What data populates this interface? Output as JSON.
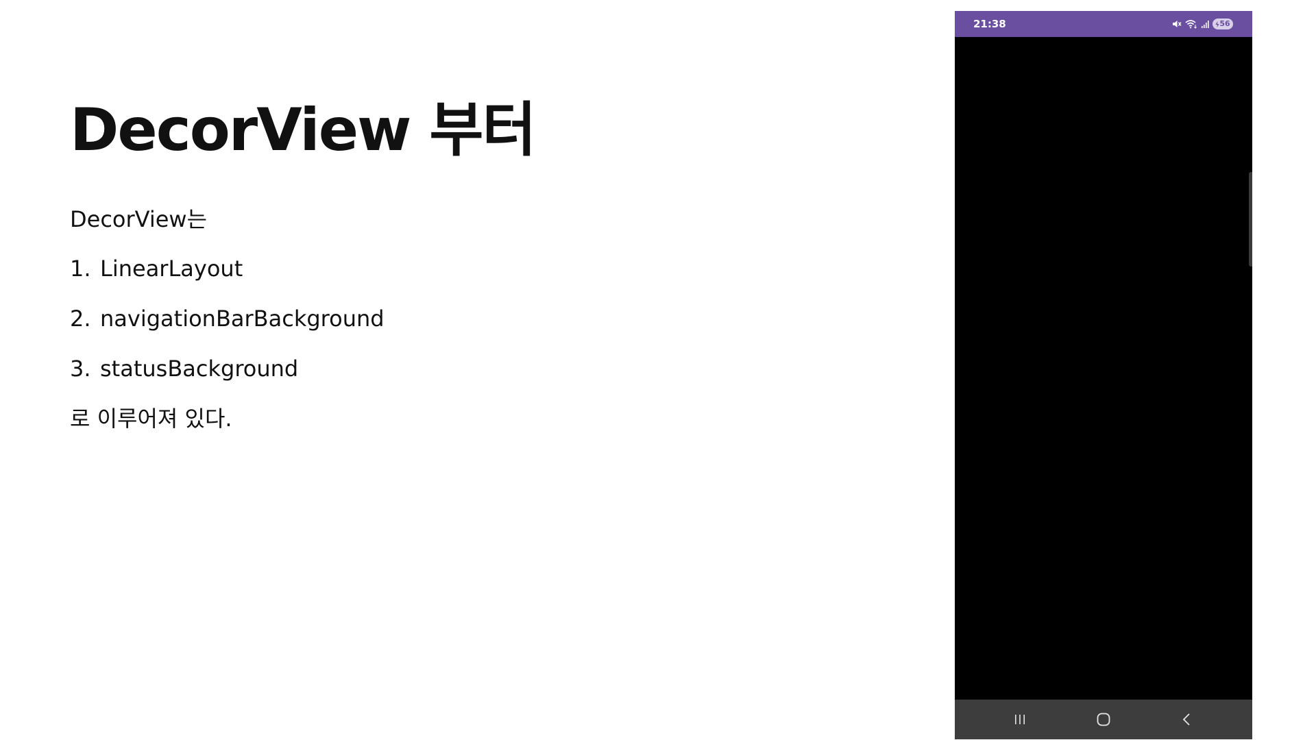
{
  "slide": {
    "title": "DecorView 부터",
    "intro": "DecorView는",
    "steps": [
      {
        "number": "1.",
        "label": "LinearLayout"
      },
      {
        "number": "2.",
        "label": "navigationBarBackground"
      },
      {
        "number": "3.",
        "label": "statusBackground"
      }
    ],
    "outro": "로 이루어져 있다."
  },
  "phone": {
    "status_bar": {
      "time": "21:38",
      "icons": [
        "mute-icon",
        "wifi-icon",
        "signal-icon"
      ],
      "battery": "56",
      "color": "#6a4fa0"
    },
    "screen_color": "#000000",
    "nav_bar": {
      "buttons": [
        "recent-apps-icon",
        "home-icon",
        "back-icon"
      ],
      "color": "#3d3d3d"
    }
  }
}
